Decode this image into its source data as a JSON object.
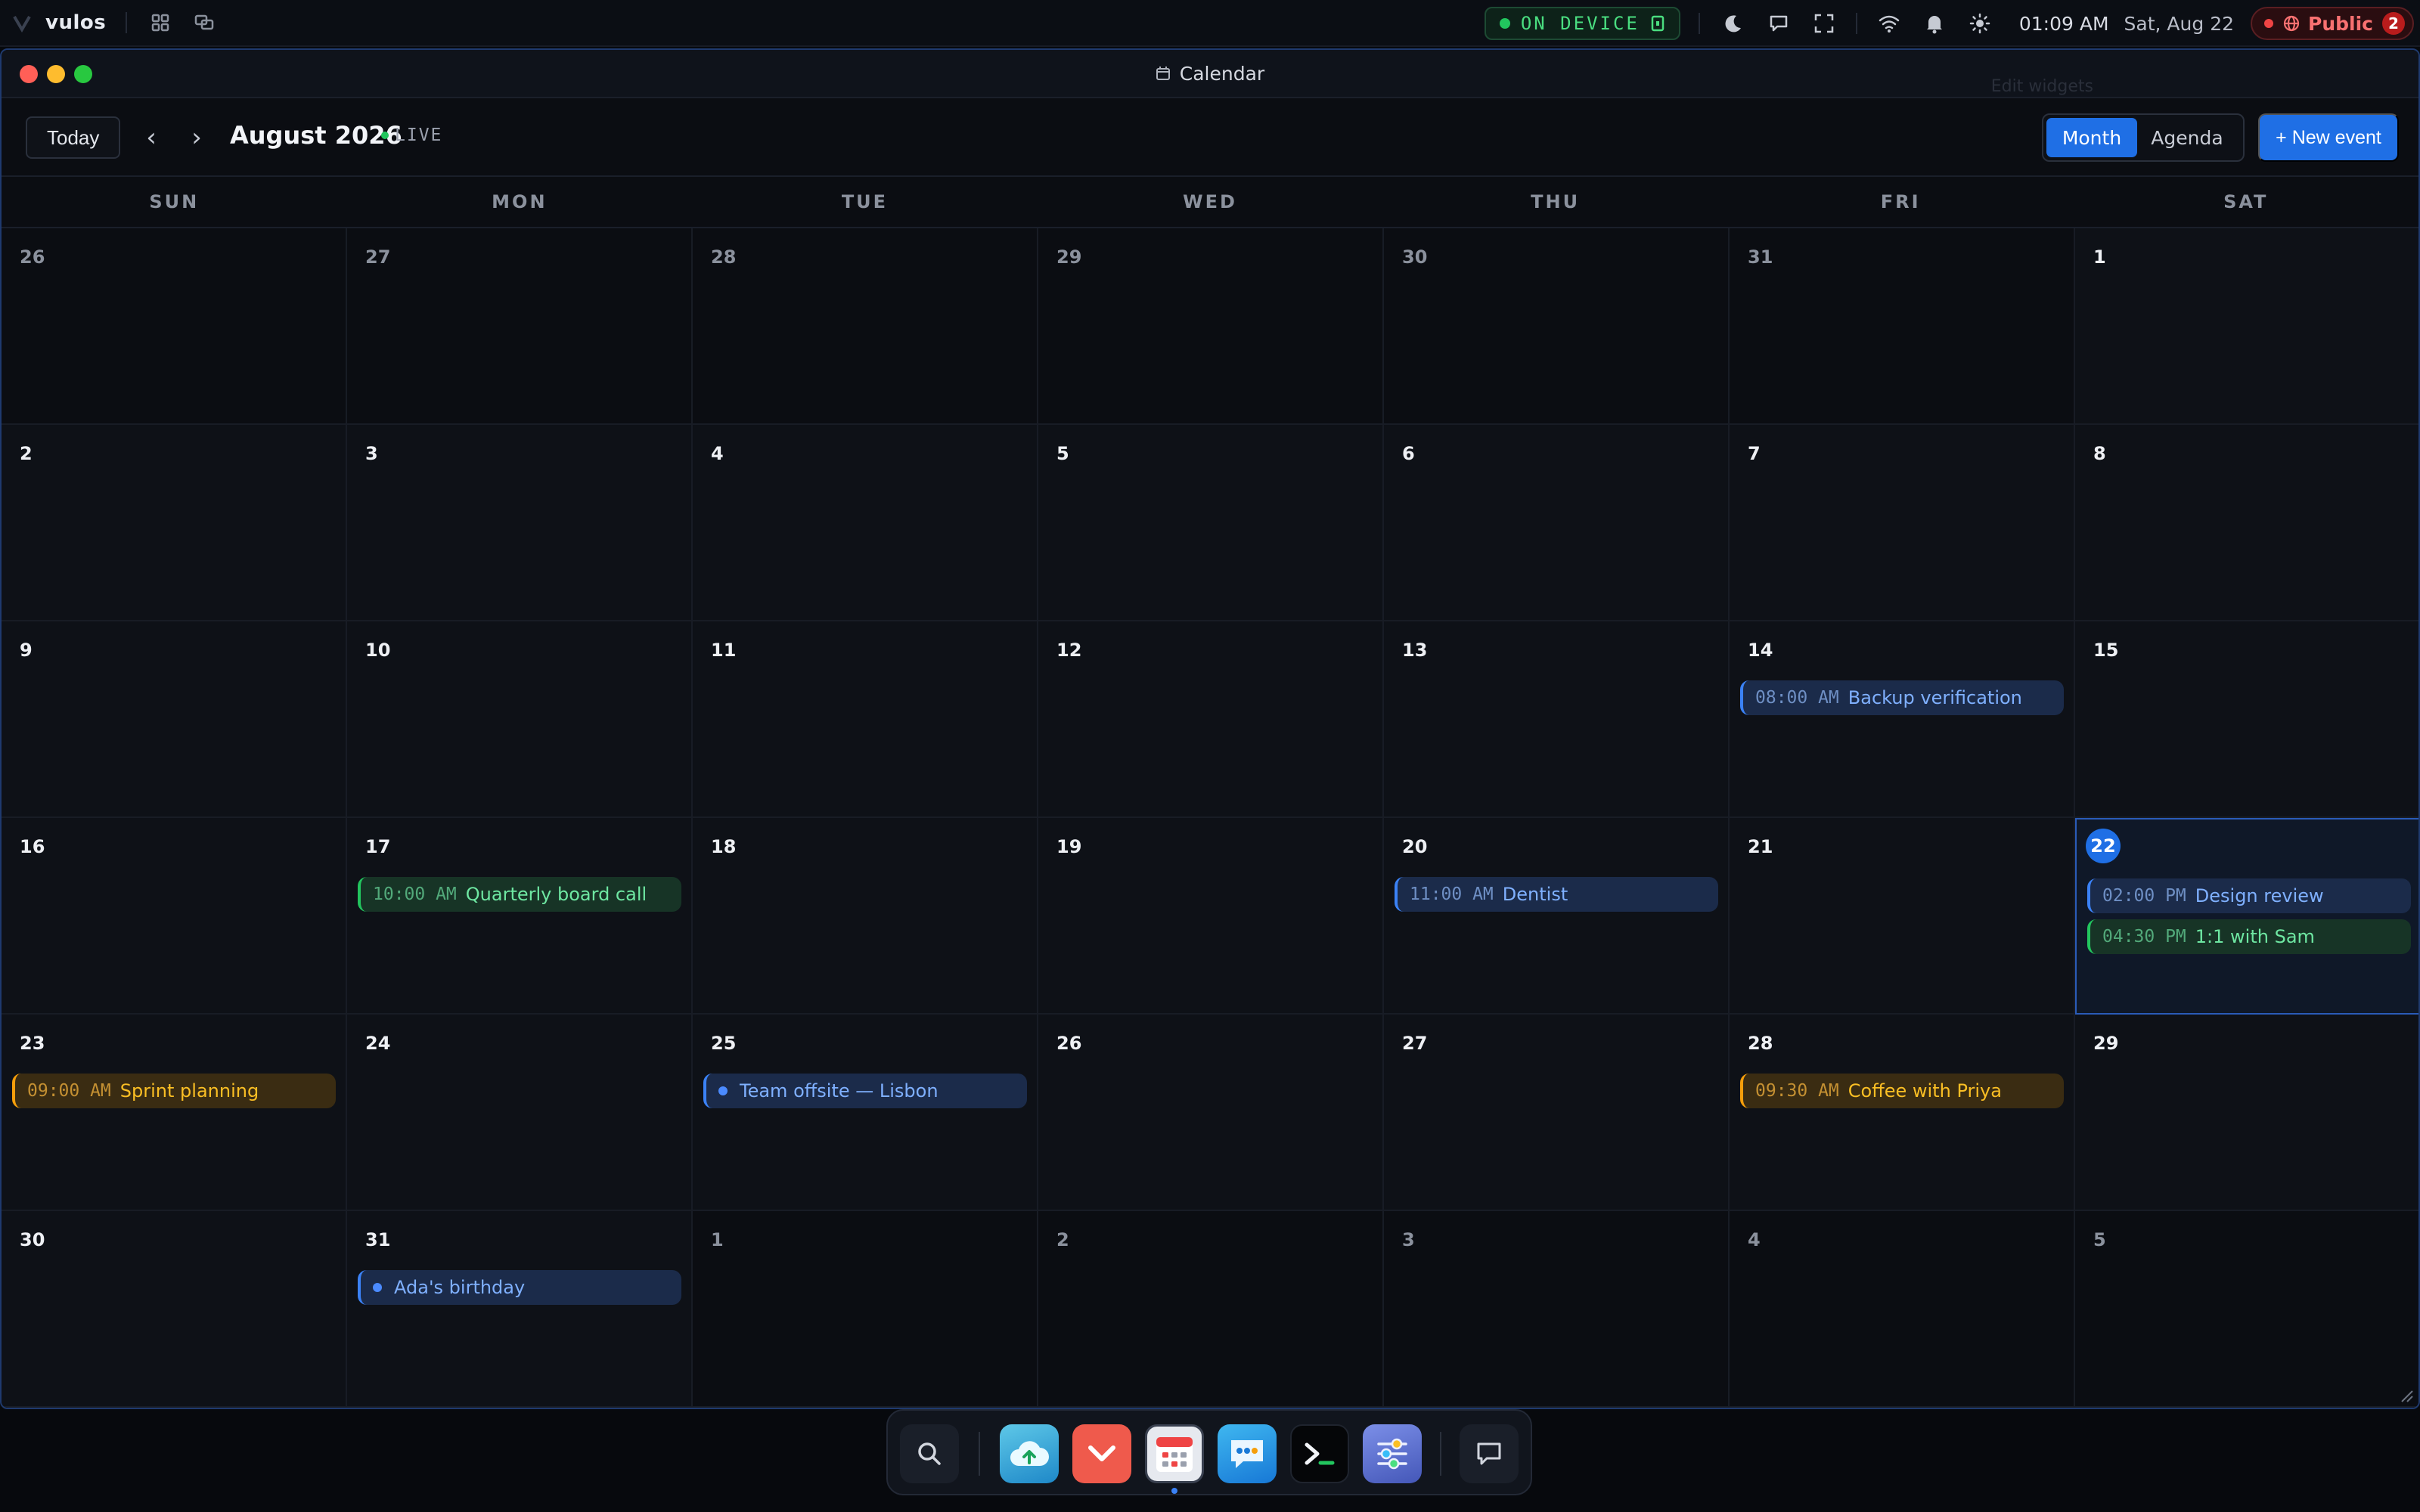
{
  "topbar": {
    "brand": "vulos",
    "device_status": "ON DEVICE",
    "clock": "01:09 AM",
    "date": "Sat, Aug 22",
    "public_label": "Public",
    "public_count": "2"
  },
  "window": {
    "title": "Calendar",
    "hint": "Edit widgets"
  },
  "toolbar": {
    "today_label": "Today",
    "prev_label": "‹",
    "next_label": "›",
    "month_title": "August 2026",
    "live_label": "LIVE",
    "view_month": "Month",
    "view_agenda": "Agenda",
    "new_event_label": "+ New event"
  },
  "weekdays": [
    "SUN",
    "MON",
    "TUE",
    "WED",
    "THU",
    "FRI",
    "SAT"
  ],
  "weeks": [
    [
      {
        "d": "26",
        "m": true
      },
      {
        "d": "27",
        "m": true
      },
      {
        "d": "28",
        "m": true
      },
      {
        "d": "29",
        "m": true
      },
      {
        "d": "30",
        "m": true
      },
      {
        "d": "31",
        "m": true
      },
      {
        "d": "1"
      }
    ],
    [
      {
        "d": "2"
      },
      {
        "d": "3"
      },
      {
        "d": "4"
      },
      {
        "d": "5"
      },
      {
        "d": "6"
      },
      {
        "d": "7"
      },
      {
        "d": "8"
      }
    ],
    [
      {
        "d": "9"
      },
      {
        "d": "10"
      },
      {
        "d": "11"
      },
      {
        "d": "12"
      },
      {
        "d": "13"
      },
      {
        "d": "14",
        "events": [
          {
            "time": "08:00 AM",
            "title": "Backup verification",
            "color": "blue"
          }
        ]
      },
      {
        "d": "15"
      }
    ],
    [
      {
        "d": "16"
      },
      {
        "d": "17",
        "events": [
          {
            "time": "10:00 AM",
            "title": "Quarterly board call",
            "color": "green"
          }
        ]
      },
      {
        "d": "18"
      },
      {
        "d": "19"
      },
      {
        "d": "20",
        "events": [
          {
            "time": "11:00 AM",
            "title": "Dentist",
            "color": "blue"
          }
        ]
      },
      {
        "d": "21"
      },
      {
        "d": "22",
        "today": true,
        "events": [
          {
            "time": "02:00 PM",
            "title": "Design review",
            "color": "blue"
          },
          {
            "time": "04:30 PM",
            "title": "1:1 with Sam",
            "color": "green"
          }
        ]
      }
    ],
    [
      {
        "d": "23",
        "events": [
          {
            "time": "09:00 AM",
            "title": "Sprint planning",
            "color": "amber"
          }
        ]
      },
      {
        "d": "24"
      },
      {
        "d": "25",
        "events": [
          {
            "time": "",
            "title": "Team offsite — Lisbon",
            "color": "blue",
            "allday": true
          }
        ]
      },
      {
        "d": "26"
      },
      {
        "d": "27"
      },
      {
        "d": "28",
        "events": [
          {
            "time": "09:30 AM",
            "title": "Coffee with Priya",
            "color": "amber"
          }
        ]
      },
      {
        "d": "29"
      }
    ],
    [
      {
        "d": "30"
      },
      {
        "d": "31",
        "events": [
          {
            "time": "",
            "title": "Ada's birthday",
            "color": "blue",
            "allday": true
          }
        ]
      },
      {
        "d": "1",
        "m": true
      },
      {
        "d": "2",
        "m": true
      },
      {
        "d": "3",
        "m": true
      },
      {
        "d": "4",
        "m": true
      },
      {
        "d": "5",
        "m": true
      }
    ]
  ],
  "dock": {
    "items": [
      "search-icon",
      "cloud-upload-icon",
      "pocket-icon",
      "calendar-icon",
      "messages-icon",
      "terminal-icon",
      "settings-sliders-icon",
      "chat-icon"
    ],
    "active": "calendar-icon"
  },
  "colors": {
    "accent": "#1f6fe5",
    "event_blue": "#3b82f6",
    "event_green": "#22c55e",
    "event_amber": "#f59e0b",
    "status_green": "#4ade80",
    "alert_red": "#ef4444"
  }
}
